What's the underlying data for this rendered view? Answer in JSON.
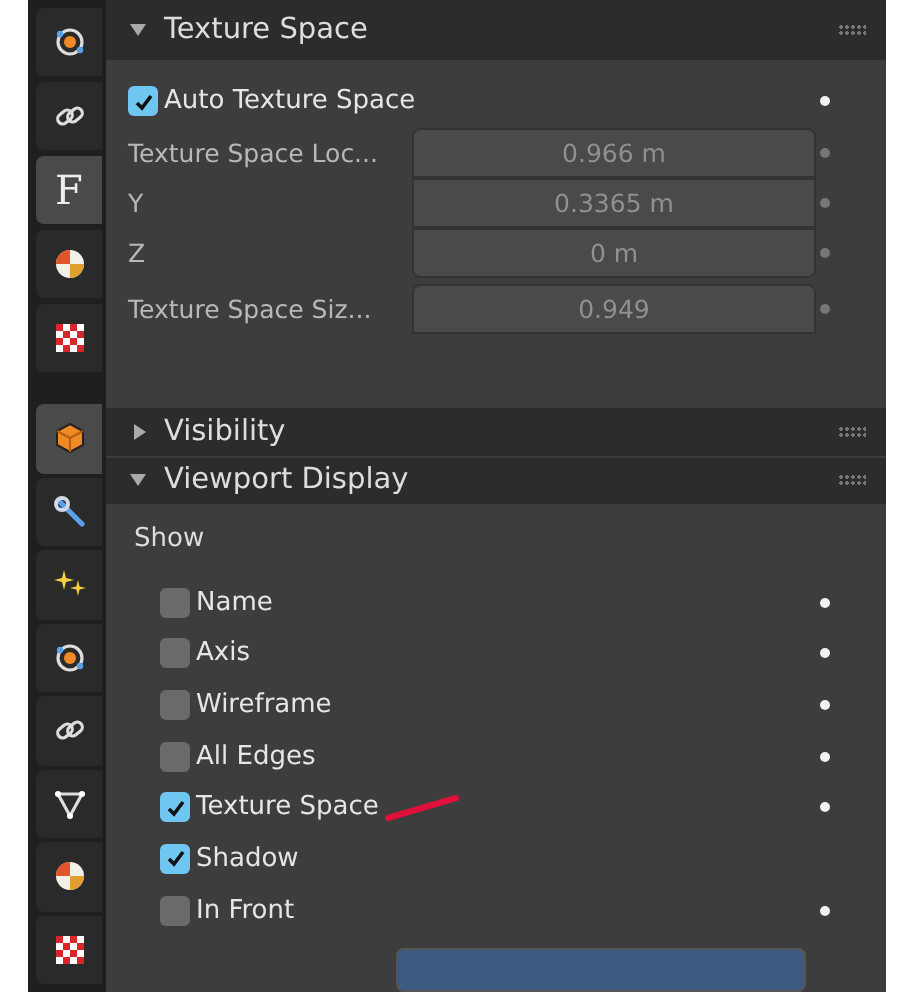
{
  "top_panel": {
    "sidebar": [
      {
        "kind": "orbit",
        "selected": false
      },
      {
        "kind": "link",
        "selected": false
      },
      {
        "kind": "letter",
        "label": "F",
        "selected": true
      },
      {
        "kind": "shading",
        "selected": false
      },
      {
        "kind": "checker",
        "selected": false
      }
    ],
    "section": {
      "title": "Texture Space",
      "expanded": true
    },
    "auto_texture_space": {
      "label": "Auto Texture Space",
      "checked": true
    },
    "fields": [
      {
        "label": "Texture Space Loc...",
        "value": "0.966 m"
      },
      {
        "label": "Y",
        "value": "0.3365 m"
      },
      {
        "label": "Z",
        "value": "0 m"
      },
      {
        "label": "Texture Space Siz...",
        "value": "0.949"
      }
    ]
  },
  "bottom_panel": {
    "sidebar": [
      {
        "kind": "cube",
        "selected": true
      },
      {
        "kind": "wrench",
        "selected": false
      },
      {
        "kind": "sparkles",
        "selected": false
      },
      {
        "kind": "orbit",
        "selected": false
      },
      {
        "kind": "link",
        "selected": false
      },
      {
        "kind": "funnel",
        "selected": false
      },
      {
        "kind": "shading",
        "selected": false
      },
      {
        "kind": "checker",
        "selected": false
      }
    ],
    "sections": [
      {
        "title": "Visibility",
        "expanded": false
      },
      {
        "title": "Viewport Display",
        "expanded": true
      }
    ],
    "show_label": "Show",
    "options": [
      {
        "label": "Name",
        "checked": false,
        "keyframe_dot": true
      },
      {
        "label": "Axis",
        "checked": false,
        "keyframe_dot": true
      },
      {
        "label": "Wireframe",
        "checked": false,
        "keyframe_dot": true
      },
      {
        "label": "All Edges",
        "checked": false,
        "keyframe_dot": true
      },
      {
        "label": "Texture Space",
        "checked": true,
        "keyframe_dot": true,
        "annotated": true
      },
      {
        "label": "Shadow",
        "checked": true,
        "keyframe_dot": false
      },
      {
        "label": "In Front",
        "checked": false,
        "keyframe_dot": true
      }
    ]
  }
}
